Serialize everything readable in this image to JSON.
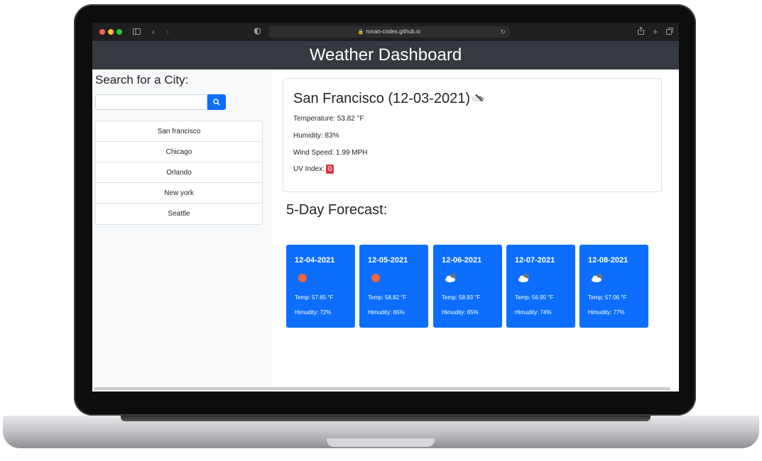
{
  "browser": {
    "url": "ronan-codes.github.io",
    "toolbar_icons": [
      "sidebar-icon",
      "back-icon",
      "forward-icon",
      "privacy-icon",
      "share-icon",
      "new-tab-icon",
      "tabs-icon"
    ]
  },
  "header": {
    "title": "Weather Dashboard"
  },
  "sidebar": {
    "title": "Search for a City:",
    "search": {
      "value": "",
      "placeholder": ""
    },
    "search_icon": "search-icon",
    "cities": [
      "San francisco",
      "Chicago",
      "Orlando",
      "New york",
      "Seattle"
    ]
  },
  "current": {
    "heading": "San Francisco (12-03-2021)",
    "icon": "cloud-icon",
    "temperature": "Temperature: 53.82 °F",
    "humidity": "Humidity: 83%",
    "wind": "Wind Speed: 1.99 MPH",
    "uv_label": "UV Index:",
    "uv_value": "0"
  },
  "forecast": {
    "title": "5-Day Forecast:",
    "days": [
      {
        "date": "12-04-2021",
        "icon": "sun-icon",
        "temp": "Temp: 57.65 °F",
        "humidity": "Himudity: 72%"
      },
      {
        "date": "12-05-2021",
        "icon": "sun-icon",
        "temp": "Temp: 58.82 °F",
        "humidity": "Himudity: 65%"
      },
      {
        "date": "12-06-2021",
        "icon": "partly-cloudy-icon",
        "temp": "Temp: 58.93 °F",
        "humidity": "Himudity: 65%"
      },
      {
        "date": "12-07-2021",
        "icon": "partly-cloudy-icon",
        "temp": "Temp: 56.95 °F",
        "humidity": "Himudity: 74%"
      },
      {
        "date": "12-08-2021",
        "icon": "partly-cloudy-icon",
        "temp": "Temp: 57.06 °F",
        "humidity": "Himudity: 77%"
      }
    ]
  },
  "colors": {
    "header": "#343a40",
    "primary": "#0d6efd",
    "danger": "#dc3545",
    "sidebar": "#f8f9fa"
  }
}
